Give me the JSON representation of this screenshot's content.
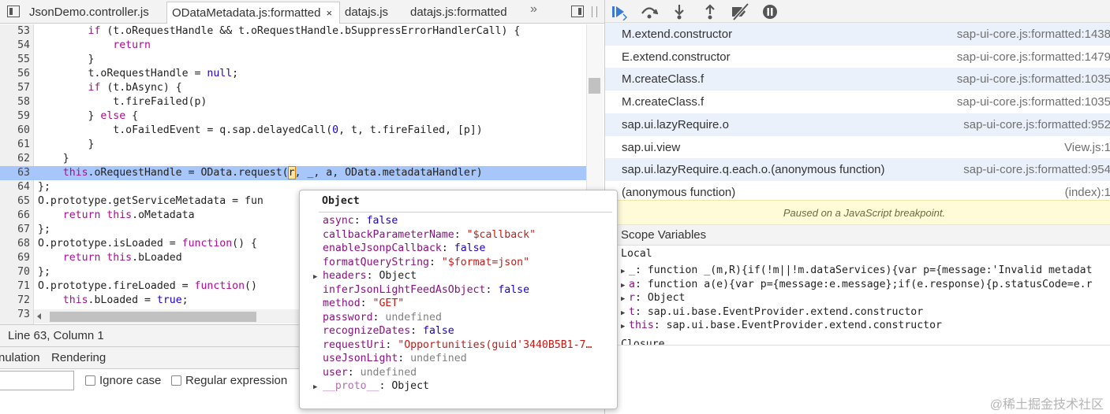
{
  "tabs": [
    {
      "label": "JsonDemo.controller.js",
      "active": false
    },
    {
      "label": "ODataMetadata.js:formatted",
      "active": true
    },
    {
      "label": "datajs.js",
      "active": false
    },
    {
      "label": "datajs.js:formatted",
      "active": false
    }
  ],
  "tab_overflow": "»",
  "tab_close_glyph": "×",
  "code_lines": [
    {
      "num": "53",
      "code": "        if (t.oRequestHandle && t.oRequestHandle.bSuppressErrorHandlerCall) {"
    },
    {
      "num": "54",
      "code": "            return"
    },
    {
      "num": "55",
      "code": "        }"
    },
    {
      "num": "56",
      "code": "        t.oRequestHandle = null;"
    },
    {
      "num": "57",
      "code": "        if (t.bAsync) {"
    },
    {
      "num": "58",
      "code": "            t.fireFailed(p)"
    },
    {
      "num": "59",
      "code": "        } else {"
    },
    {
      "num": "60",
      "code": "            t.oFailedEvent = q.sap.delayedCall(0, t, t.fireFailed, [p])"
    },
    {
      "num": "61",
      "code": "        }"
    },
    {
      "num": "62",
      "code": "    }"
    },
    {
      "num": "63",
      "code": "    this.oRequestHandle = OData.request(r, _, a, OData.metadataHandler)"
    },
    {
      "num": "64",
      "code": "};"
    },
    {
      "num": "65",
      "code": "O.prototype.getServiceMetadata = fun"
    },
    {
      "num": "66",
      "code": "    return this.oMetadata"
    },
    {
      "num": "67",
      "code": "};"
    },
    {
      "num": "68",
      "code": "O.prototype.isLoaded = function() {"
    },
    {
      "num": "69",
      "code": "    return this.bLoaded"
    },
    {
      "num": "70",
      "code": "};"
    },
    {
      "num": "71",
      "code": "O.prototype.fireLoaded = function()"
    },
    {
      "num": "72",
      "code": "    this.bLoaded = true;"
    },
    {
      "num": "73",
      "code": ""
    }
  ],
  "highlighted_line": "63",
  "status_bar": "Line 63, Column 1",
  "drawer": {
    "tab_emulation": "nulation",
    "tab_rendering": "Rendering",
    "ignore_case_label": "Ignore case",
    "regex_label": "Regular expression"
  },
  "call_stack": [
    {
      "fn": "M.extend.constructor",
      "loc": "sap-ui-core.js:formatted:1438"
    },
    {
      "fn": "E.extend.constructor",
      "loc": "sap-ui-core.js:formatted:1479"
    },
    {
      "fn": "M.createClass.f",
      "loc": "sap-ui-core.js:formatted:1035"
    },
    {
      "fn": "M.createClass.f",
      "loc": "sap-ui-core.js:formatted:1035"
    },
    {
      "fn": "sap.ui.lazyRequire.o",
      "loc": "sap-ui-core.js:formatted:952"
    },
    {
      "fn": "sap.ui.view",
      "loc": "View.js:1"
    },
    {
      "fn": "sap.ui.lazyRequire.q.each.o.(anonymous function)",
      "loc": "sap-ui-core.js:formatted:954"
    },
    {
      "fn": "(anonymous function)",
      "loc": "(index):1"
    }
  ],
  "paused_message": "Paused on a JavaScript breakpoint.",
  "scope": {
    "header": "Scope Variables",
    "section_local": "Local",
    "section_closure": "Closure",
    "vars": [
      {
        "key": "_",
        "value": "function _(m,R){if(!m||!m.dataServices){var p={message:'Invalid metadat"
      },
      {
        "key": "a",
        "value": "function a(e){var p={message:e.message};if(e.response){p.statusCode=e.r"
      },
      {
        "key": "r",
        "value": "Object"
      },
      {
        "key": "t",
        "value": "sap.ui.base.EventProvider.extend.constructor"
      },
      {
        "key": "this",
        "value": "sap.ui.base.EventProvider.extend.constructor"
      }
    ]
  },
  "popover": {
    "title": "Object",
    "props": [
      {
        "key": "async",
        "value": "false",
        "type": "bool",
        "expandable": false
      },
      {
        "key": "callbackParameterName",
        "value": "\"$callback\"",
        "type": "str",
        "expandable": false
      },
      {
        "key": "enableJsonpCallback",
        "value": "false",
        "type": "bool",
        "expandable": false
      },
      {
        "key": "formatQueryString",
        "value": "\"$format=json\"",
        "type": "str",
        "expandable": false
      },
      {
        "key": "headers",
        "value": "Object",
        "type": "obj",
        "expandable": true
      },
      {
        "key": "inferJsonLightFeedAsObject",
        "value": "false",
        "type": "bool",
        "expandable": false
      },
      {
        "key": "method",
        "value": "\"GET\"",
        "type": "str",
        "expandable": false
      },
      {
        "key": "password",
        "value": "undefined",
        "type": "undef",
        "expandable": false
      },
      {
        "key": "recognizeDates",
        "value": "false",
        "type": "bool",
        "expandable": false
      },
      {
        "key": "requestUri",
        "value": "\"Opportunities(guid'3440B5B1-7…",
        "type": "str",
        "expandable": false
      },
      {
        "key": "useJsonLight",
        "value": "undefined",
        "type": "undef",
        "expandable": false
      },
      {
        "key": "user",
        "value": "undefined",
        "type": "undef",
        "expandable": false
      },
      {
        "key": "__proto__",
        "value": "Object",
        "type": "obj",
        "expandable": true
      }
    ]
  },
  "watermark": "@稀土掘金技术社区"
}
